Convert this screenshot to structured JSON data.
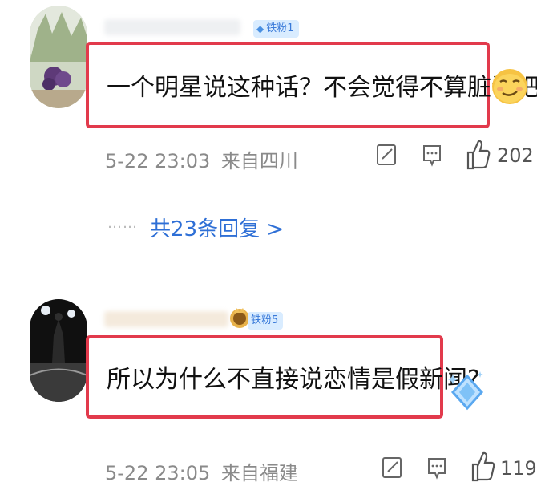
{
  "comments": [
    {
      "badge_label": "铁粉1",
      "text": "一个明星说这种话？不会觉得不算脏话吧",
      "emoji": "smirk-emoji",
      "date": "5-22 23:03",
      "location": "来自四川",
      "likes": "202"
    },
    {
      "badge_label": "铁粉5",
      "text": "所以为什么不直接说恋情是假新闻?",
      "emoji": "diamond-sticker",
      "date": "5-22 23:05",
      "location": "来自福建",
      "likes": "119"
    }
  ],
  "replies": {
    "dots": "……",
    "label": "共23条回复 >"
  },
  "colors": {
    "highlight_border": "#e23a4c",
    "link": "#2e6fd6",
    "meta": "#8a8a8a",
    "badge_bg": "#d9ecff"
  }
}
